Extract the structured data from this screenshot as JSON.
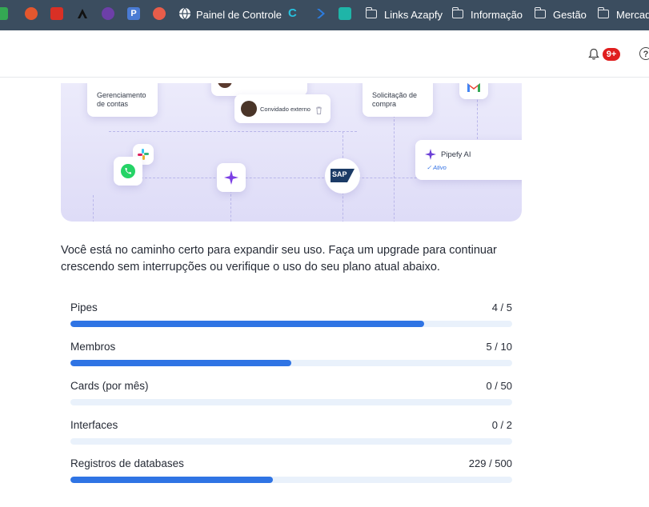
{
  "bookmarks": {
    "items": [
      {
        "label": "Painel de Controle"
      },
      {
        "label": "Links Azapfy"
      },
      {
        "label": "Informação"
      },
      {
        "label": "Gestão"
      },
      {
        "label": "Mercad"
      }
    ]
  },
  "header": {
    "notifications_badge": "9+",
    "help_glyph": "?"
  },
  "hero": {
    "card_accounts": "Gerenciamento de contas",
    "card_guest": "Convidado externo",
    "card_purchase": "Solicitação de compra",
    "pipefy_ai_title": "Pipefy AI",
    "pipefy_ai_status": "✓ Ativo",
    "sap_label": "SAP"
  },
  "intro_text": "Você está no caminho certo para expandir seu uso. Faça um upgrade para continuar crescendo sem interrupções ou verifique o uso do seu plano atual abaixo.",
  "usage": [
    {
      "label": "Pipes",
      "value": "4 / 5",
      "used": 4,
      "limit": 5
    },
    {
      "label": "Membros",
      "value": "5 / 10",
      "used": 5,
      "limit": 10
    },
    {
      "label": "Cards (por mês)",
      "value": "0 / 50",
      "used": 0,
      "limit": 50
    },
    {
      "label": "Interfaces",
      "value": "0 / 2",
      "used": 0,
      "limit": 2
    },
    {
      "label": "Registros de databases",
      "value": "229 / 500",
      "used": 229,
      "limit": 500
    }
  ],
  "colors": {
    "bar_fill": "#2f74e4",
    "bar_track": "#e9f1fb",
    "badge": "#e01e1e",
    "bookmarks_bg": "#3b4d5f"
  }
}
